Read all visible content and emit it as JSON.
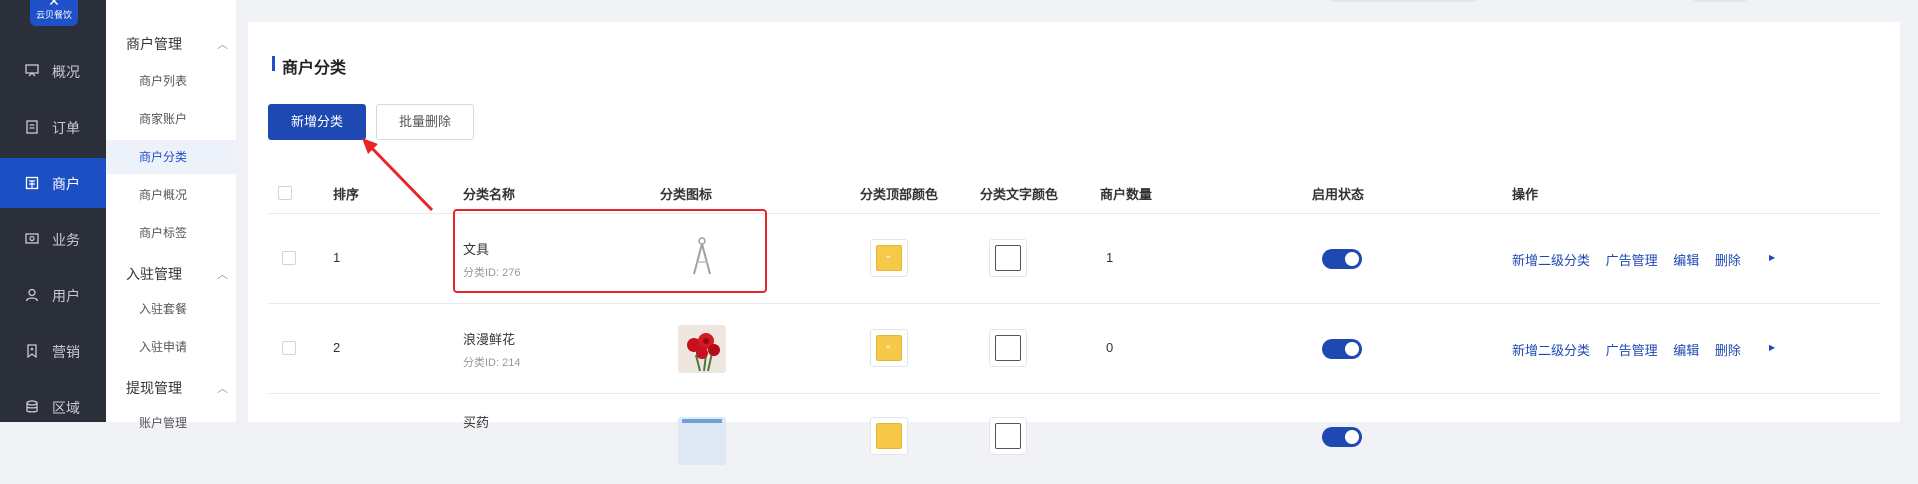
{
  "logo": {
    "text": "云贝餐饮"
  },
  "rail": [
    {
      "label": "概况",
      "icon": "chart-board-icon"
    },
    {
      "label": "订单",
      "icon": "document-icon"
    },
    {
      "label": "商户",
      "icon": "store-icon",
      "active": true
    },
    {
      "label": "业务",
      "icon": "monitor-icon"
    },
    {
      "label": "用户",
      "icon": "user-icon"
    },
    {
      "label": "营销",
      "icon": "tag-icon"
    },
    {
      "label": "区域",
      "icon": "database-icon"
    }
  ],
  "submenu": {
    "groups": [
      {
        "label": "商户管理",
        "items": [
          "商户列表",
          "商家账户",
          "商户分类",
          "商户概况",
          "商户标签"
        ]
      },
      {
        "label": "入驻管理",
        "items": [
          "入驻套餐",
          "入驻申请"
        ]
      },
      {
        "label": "提现管理",
        "items": [
          "账户管理"
        ]
      }
    ],
    "active_item": "商户分类"
  },
  "page": {
    "title": "商户分类",
    "add_button": "新增分类",
    "batch_delete_button": "批量删除"
  },
  "table": {
    "headers": {
      "order": "排序",
      "name": "分类名称",
      "icon": "分类图标",
      "top_color": "分类顶部颜色",
      "text_color": "分类文字颜色",
      "count": "商户数量",
      "status": "启用状态",
      "ops": "操作"
    },
    "rows": [
      {
        "order": "1",
        "name": "文具",
        "id_text": "分类ID: 276",
        "count": "1",
        "top_color": "#f7c948",
        "text_color": "#ffffff",
        "enabled": true,
        "icon": "compass-icon"
      },
      {
        "order": "2",
        "name": "浪漫鲜花",
        "id_text": "分类ID: 214",
        "count": "0",
        "top_color": "#f7c948",
        "text_color": "#ffffff",
        "enabled": true,
        "icon": "rose-icon"
      },
      {
        "order": "",
        "name": "买药",
        "id_text": "",
        "count": "",
        "top_color": "#f7c948",
        "text_color": "#ffffff",
        "enabled": true,
        "icon": "medicine-icon"
      }
    ],
    "ops": [
      "新增二级分类",
      "广告管理",
      "编辑",
      "删除"
    ]
  },
  "colors": {
    "brand": "#1e49b3",
    "annotation": "#e8262a",
    "rail_bg": "#2b2f3a"
  }
}
